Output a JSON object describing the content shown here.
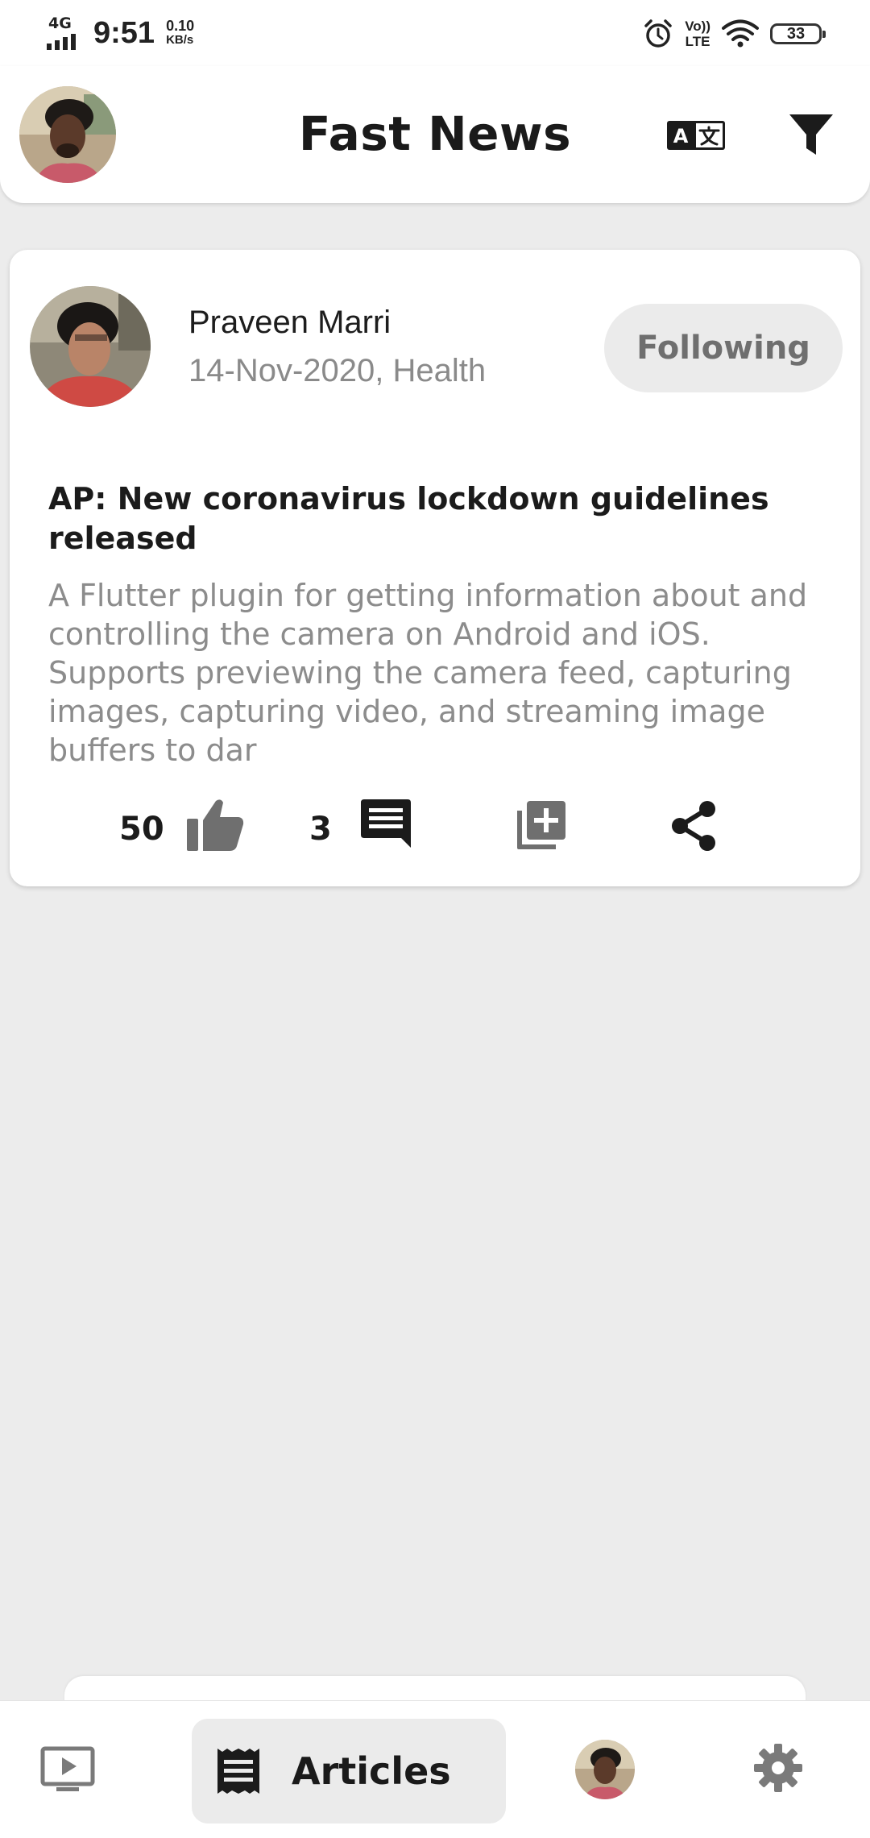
{
  "status_bar": {
    "network": "4G",
    "time": "9:51",
    "speed_value": "0.10",
    "speed_unit": "KB/s",
    "volte_top": "Vo))",
    "volte_bottom": "LTE",
    "battery": "33",
    "icons": [
      "signal-icon",
      "alarm-icon",
      "wifi-icon",
      "battery-icon"
    ]
  },
  "app_bar": {
    "title": "Fast News",
    "icons": [
      "profile-avatar",
      "translate-icon",
      "filter-icon"
    ]
  },
  "article": {
    "author_name": "Praveen Marri",
    "meta": "14-Nov-2020, Health",
    "follow_label": "Following",
    "title": "AP: New coronavirus lockdown guidelines released",
    "body": "A Flutter plugin for getting information about and controlling the camera on Android and iOS. Supports previewing the camera feed, capturing images, capturing video, and streaming image buffers to dar",
    "likes": "50",
    "comments": "3",
    "icons": [
      "thumbs-up-icon",
      "comment-icon",
      "add-to-library-icon",
      "share-icon"
    ]
  },
  "bottom_nav": {
    "items": [
      {
        "name": "video",
        "icon": "video-icon"
      },
      {
        "name": "articles",
        "label": "Articles",
        "icon": "article-icon",
        "active": true
      },
      {
        "name": "profile",
        "icon": "profile-avatar"
      },
      {
        "name": "settings",
        "icon": "gear-icon"
      }
    ]
  },
  "colors": {
    "background": "#ececec",
    "card": "#ffffff",
    "pill": "#ebebeb",
    "muted_text": "#8c8c8c",
    "icon_dark": "#1b1b1b",
    "icon_grey": "#6f6f6f"
  }
}
